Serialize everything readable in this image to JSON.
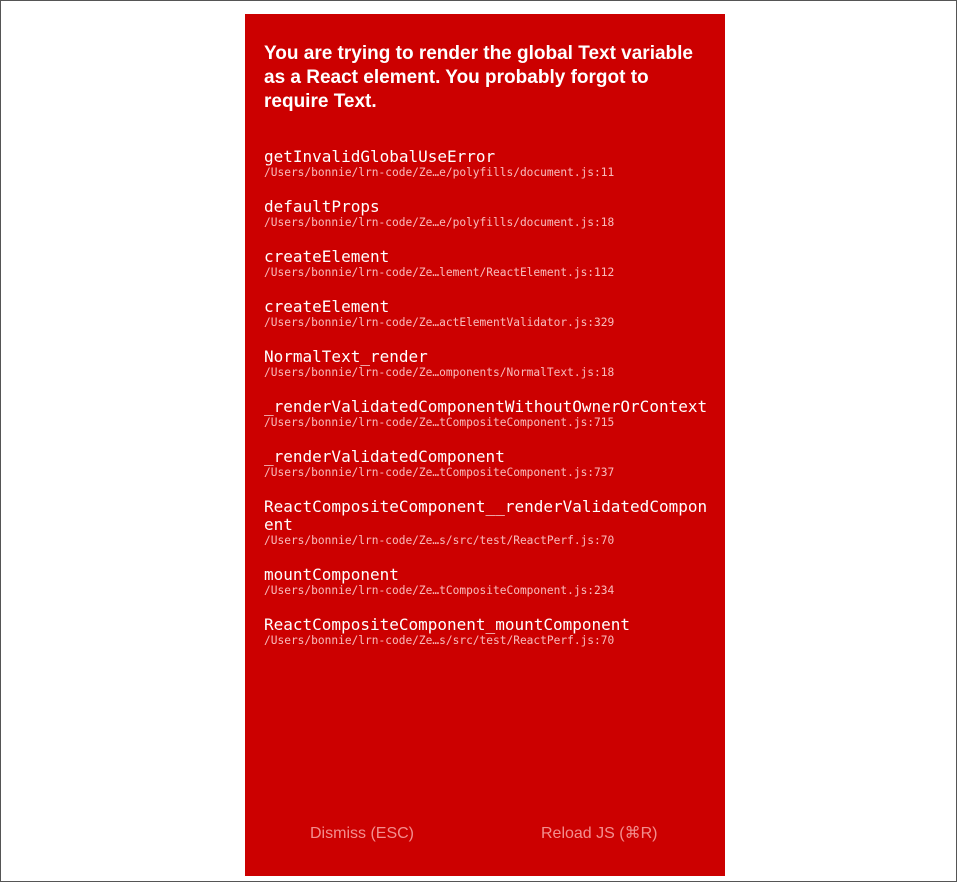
{
  "error": {
    "message": "You are trying to render the global Text variable as a React element. You probably forgot to require Text."
  },
  "stack": [
    {
      "fn": "getInvalidGlobalUseError",
      "loc": "/Users/bonnie/lrn-code/Ze…e/polyfills/document.js:11"
    },
    {
      "fn": "defaultProps",
      "loc": "/Users/bonnie/lrn-code/Ze…e/polyfills/document.js:18"
    },
    {
      "fn": "createElement",
      "loc": "/Users/bonnie/lrn-code/Ze…lement/ReactElement.js:112"
    },
    {
      "fn": "createElement",
      "loc": "/Users/bonnie/lrn-code/Ze…actElementValidator.js:329"
    },
    {
      "fn": "NormalText_render",
      "loc": "/Users/bonnie/lrn-code/Ze…omponents/NormalText.js:18"
    },
    {
      "fn": "_renderValidatedComponentWithoutOwnerOrContext",
      "loc": "/Users/bonnie/lrn-code/Ze…tCompositeComponent.js:715"
    },
    {
      "fn": "_renderValidatedComponent",
      "loc": "/Users/bonnie/lrn-code/Ze…tCompositeComponent.js:737"
    },
    {
      "fn": "ReactCompositeComponent__renderValidatedComponent",
      "loc": "/Users/bonnie/lrn-code/Ze…s/src/test/ReactPerf.js:70"
    },
    {
      "fn": "mountComponent",
      "loc": "/Users/bonnie/lrn-code/Ze…tCompositeComponent.js:234"
    },
    {
      "fn": "ReactCompositeComponent_mountComponent",
      "loc": "/Users/bonnie/lrn-code/Ze…s/src/test/ReactPerf.js:70"
    }
  ],
  "buttons": {
    "dismiss": "Dismiss (ESC)",
    "reload": "Reload JS (⌘R)"
  },
  "colors": {
    "background": "#cc0000",
    "text": "#ffffff"
  }
}
